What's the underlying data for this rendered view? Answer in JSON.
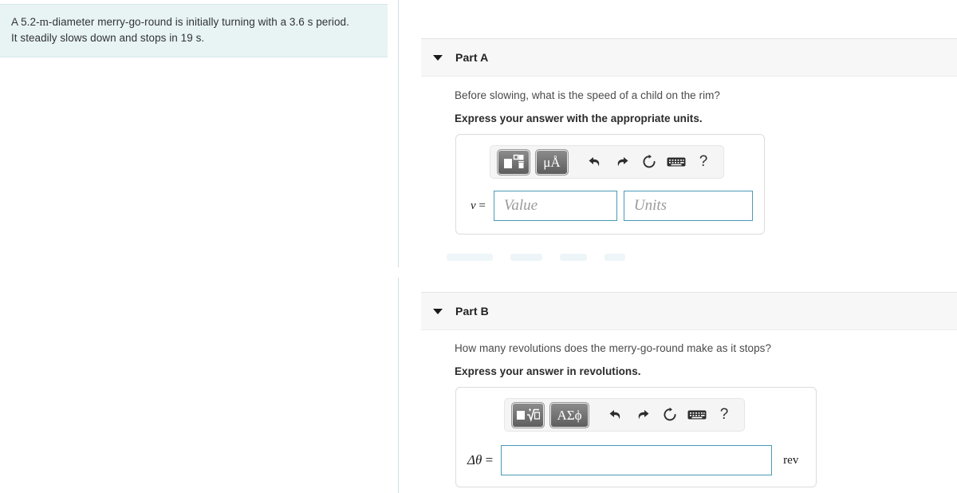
{
  "problem": {
    "line1_pre": "A 5.2-",
    "line1_unit": "m",
    "line1_post": "-diameter merry-go-round is initially turning with a 3.6 s period.",
    "line2": "It steadily slows down and stops in 19 s."
  },
  "parts": [
    {
      "id": "part-a",
      "title": "Part A",
      "caret_icon": "caret-down-icon",
      "question": "Before slowing, what is the speed of a child on the rim?",
      "instruction": "Express your answer with the appropriate units.",
      "toolbar": {
        "template_button_label": "",
        "template_icon": "math-template-icon",
        "units_button_label": "μÅ",
        "undo_icon": "undo-icon",
        "redo_icon": "redo-icon",
        "reset_icon": "reset-icon",
        "keyboard_icon": "keyboard-icon",
        "help_label": "?"
      },
      "input": {
        "variable": "v",
        "equals": " =",
        "value_placeholder": "Value",
        "value": "",
        "units_placeholder": "Units",
        "units": "",
        "suffix": ""
      }
    },
    {
      "id": "part-b",
      "title": "Part B",
      "caret_icon": "caret-down-icon",
      "question": "How many revolutions does the merry-go-round make as it stops?",
      "instruction": "Express your answer in revolutions.",
      "toolbar": {
        "template_button_label": "",
        "template_icon": "math-radical-icon",
        "units_button_label": "ΑΣϕ",
        "undo_icon": "undo-icon",
        "redo_icon": "redo-icon",
        "reset_icon": "reset-icon",
        "keyboard_icon": "keyboard-icon",
        "help_label": "?"
      },
      "input": {
        "variable": "Δθ",
        "equals": " =",
        "value_placeholder": "",
        "value": "",
        "units_placeholder": "",
        "units": "",
        "suffix": "rev"
      }
    }
  ],
  "colors": {
    "problem_background": "#e8f4f4",
    "header_background": "#f7f7f7",
    "input_border": "#4a9ab5",
    "divider": "#cddfe4"
  }
}
